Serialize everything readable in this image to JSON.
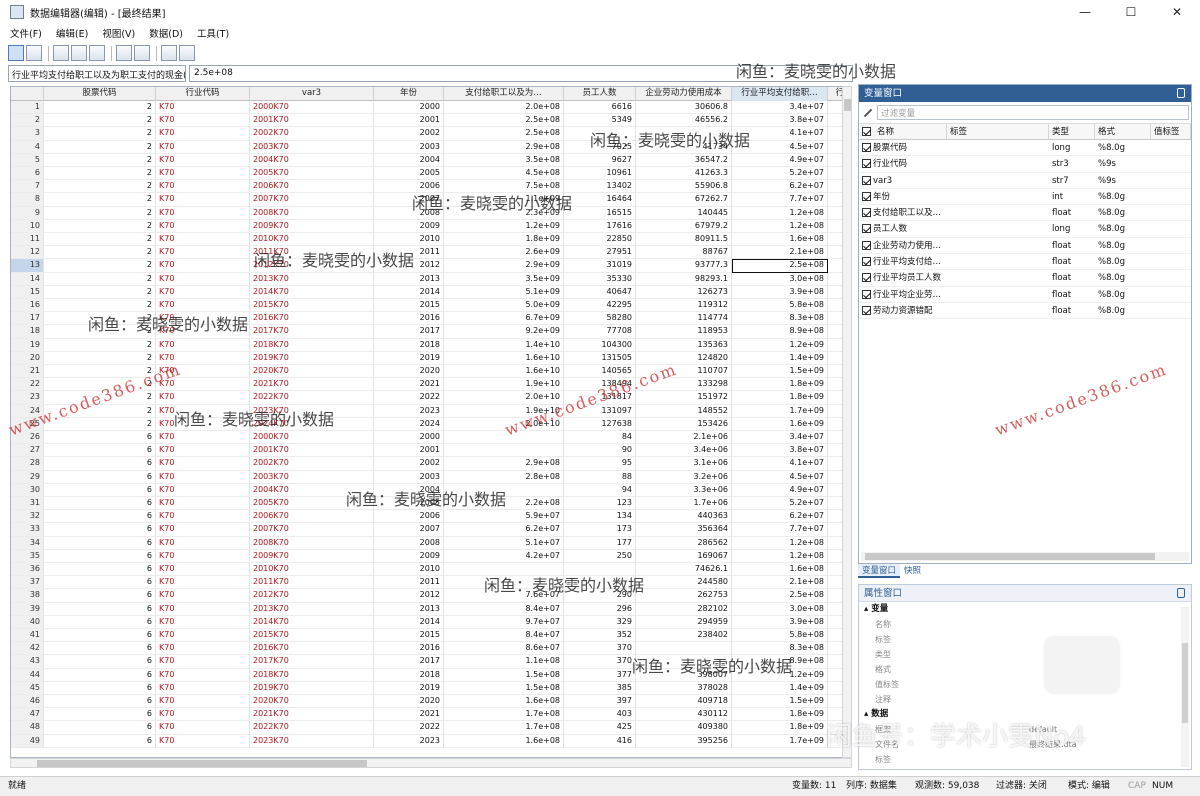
{
  "window": {
    "title": "数据编辑器(编辑) - [最终结果]",
    "minimize": "—",
    "maximize": "☐",
    "close": "✕"
  },
  "menu": [
    "文件(F)",
    "编辑(E)",
    "视图(V)",
    "数据(D)",
    "工具(T)"
  ],
  "toolbar_icons": [
    "grid-view-icon",
    "dropdown-grid-icon",
    "open-icon",
    "save-icon",
    "print-icon",
    "copy-icon",
    "paste-icon",
    "search-icon",
    "filter-icon"
  ],
  "cell_editor": {
    "variable_label": "行业平均支付给职工以及为职工支付的现金(",
    "value": "2.5e+08"
  },
  "grid": {
    "columns": [
      "股票代码",
      "行业代码",
      "var3",
      "年份",
      "支付给职工以及为…",
      "员工人数",
      "企业劳动力使用成本",
      "行业平均支付给职…",
      "行"
    ],
    "current_row": 13,
    "rows": [
      [
        "1",
        "2",
        "K70",
        "2000K70",
        "2000",
        "2.0e+08",
        "6616",
        "30606.8",
        "3.4e+07"
      ],
      [
        "2",
        "2",
        "K70",
        "2001K70",
        "2001",
        "2.5e+08",
        "5349",
        "46556.2",
        "3.8e+07"
      ],
      [
        "3",
        "2",
        "K70",
        "2002K70",
        "2002",
        "2.5e+08",
        "",
        "",
        "4.1e+07"
      ],
      [
        "4",
        "2",
        "K70",
        "2003K70",
        "2003",
        "2.9e+08",
        "7025",
        "41734",
        "4.5e+07"
      ],
      [
        "5",
        "2",
        "K70",
        "2004K70",
        "2004",
        "3.5e+08",
        "9627",
        "36547.2",
        "4.9e+07"
      ],
      [
        "6",
        "2",
        "K70",
        "2005K70",
        "2005",
        "4.5e+08",
        "10961",
        "41263.3",
        "5.2e+07"
      ],
      [
        "7",
        "2",
        "K70",
        "2006K70",
        "2006",
        "7.5e+08",
        "13402",
        "55906.8",
        "6.2e+07"
      ],
      [
        "8",
        "2",
        "K70",
        "2007K70",
        "2007",
        "1.1e+09",
        "16464",
        "67262.7",
        "7.7e+07"
      ],
      [
        "9",
        "2",
        "K70",
        "2008K70",
        "2008",
        "2.3e+09",
        "16515",
        "140445",
        "1.2e+08"
      ],
      [
        "10",
        "2",
        "K70",
        "2009K70",
        "2009",
        "1.2e+09",
        "17616",
        "67979.2",
        "1.2e+08"
      ],
      [
        "11",
        "2",
        "K70",
        "2010K70",
        "2010",
        "1.8e+09",
        "22850",
        "80911.5",
        "1.6e+08"
      ],
      [
        "12",
        "2",
        "K70",
        "2011K70",
        "2011",
        "2.6e+09",
        "27951",
        "88767",
        "2.1e+08"
      ],
      [
        "13",
        "2",
        "K70",
        "2012K70",
        "2012",
        "2.9e+09",
        "31019",
        "93777.3",
        "2.5e+08"
      ],
      [
        "14",
        "2",
        "K70",
        "2013K70",
        "2013",
        "3.5e+09",
        "35330",
        "98293.1",
        "3.0e+08"
      ],
      [
        "15",
        "2",
        "K70",
        "2014K70",
        "2014",
        "5.1e+09",
        "40647",
        "126273",
        "3.9e+08"
      ],
      [
        "16",
        "2",
        "K70",
        "2015K70",
        "2015",
        "5.0e+09",
        "42295",
        "119312",
        "5.8e+08"
      ],
      [
        "17",
        "2",
        "K70",
        "2016K70",
        "2016",
        "6.7e+09",
        "58280",
        "114774",
        "8.3e+08"
      ],
      [
        "18",
        "2",
        "K70",
        "2017K70",
        "2017",
        "9.2e+09",
        "77708",
        "118953",
        "8.9e+08"
      ],
      [
        "19",
        "2",
        "K70",
        "2018K70",
        "2018",
        "1.4e+10",
        "104300",
        "135363",
        "1.2e+09"
      ],
      [
        "20",
        "2",
        "K70",
        "2019K70",
        "2019",
        "1.6e+10",
        "131505",
        "124820",
        "1.4e+09"
      ],
      [
        "21",
        "2",
        "K70",
        "2020K70",
        "2020",
        "1.6e+10",
        "140565",
        "110707",
        "1.5e+09"
      ],
      [
        "22",
        "2",
        "K70",
        "2021K70",
        "2021",
        "1.9e+10",
        "138494",
        "133298",
        "1.8e+09"
      ],
      [
        "23",
        "2",
        "K70",
        "2022K70",
        "2022",
        "2.0e+10",
        "131817",
        "151972",
        "1.8e+09"
      ],
      [
        "24",
        "2",
        "K70",
        "2023K70",
        "2023",
        "1.9e+10",
        "131097",
        "148552",
        "1.7e+09"
      ],
      [
        "25",
        "2",
        "K70",
        "2024K70",
        "2024",
        "2.0e+10",
        "127638",
        "153426",
        "1.6e+09"
      ],
      [
        "26",
        "6",
        "K70",
        "2000K70",
        "2000",
        "",
        "84",
        "2.1e+06",
        "3.4e+07"
      ],
      [
        "27",
        "6",
        "K70",
        "2001K70",
        "2001",
        "",
        "90",
        "3.4e+06",
        "3.8e+07"
      ],
      [
        "28",
        "6",
        "K70",
        "2002K70",
        "2002",
        "2.9e+08",
        "95",
        "3.1e+06",
        "4.1e+07"
      ],
      [
        "29",
        "6",
        "K70",
        "2003K70",
        "2003",
        "2.8e+08",
        "88",
        "3.2e+06",
        "4.5e+07"
      ],
      [
        "30",
        "6",
        "K70",
        "2004K70",
        "2004",
        "",
        "94",
        "3.3e+06",
        "4.9e+07"
      ],
      [
        "31",
        "6",
        "K70",
        "2005K70",
        "2005",
        "2.2e+08",
        "123",
        "1.7e+06",
        "5.2e+07"
      ],
      [
        "32",
        "6",
        "K70",
        "2006K70",
        "2006",
        "5.9e+07",
        "134",
        "440363",
        "6.2e+07"
      ],
      [
        "33",
        "6",
        "K70",
        "2007K70",
        "2007",
        "6.2e+07",
        "173",
        "356364",
        "7.7e+07"
      ],
      [
        "34",
        "6",
        "K70",
        "2008K70",
        "2008",
        "5.1e+07",
        "177",
        "286562",
        "1.2e+08"
      ],
      [
        "35",
        "6",
        "K70",
        "2009K70",
        "2009",
        "4.2e+07",
        "250",
        "169067",
        "1.2e+08"
      ],
      [
        "36",
        "6",
        "K70",
        "2010K70",
        "2010",
        "",
        "",
        "74626.1",
        "1.6e+08"
      ],
      [
        "37",
        "6",
        "K70",
        "2011K70",
        "2011",
        "",
        "",
        "244580",
        "2.1e+08"
      ],
      [
        "38",
        "6",
        "K70",
        "2012K70",
        "2012",
        "7.6e+07",
        "290",
        "262753",
        "2.5e+08"
      ],
      [
        "39",
        "6",
        "K70",
        "2013K70",
        "2013",
        "8.4e+07",
        "296",
        "282102",
        "3.0e+08"
      ],
      [
        "40",
        "6",
        "K70",
        "2014K70",
        "2014",
        "9.7e+07",
        "329",
        "294959",
        "3.9e+08"
      ],
      [
        "41",
        "6",
        "K70",
        "2015K70",
        "2015",
        "8.4e+07",
        "352",
        "238402",
        "5.8e+08"
      ],
      [
        "42",
        "6",
        "K70",
        "2016K70",
        "2016",
        "8.6e+07",
        "370",
        "",
        "8.3e+08"
      ],
      [
        "43",
        "6",
        "K70",
        "2017K70",
        "2017",
        "1.1e+08",
        "370",
        "",
        "8.9e+08"
      ],
      [
        "44",
        "6",
        "K70",
        "2018K70",
        "2018",
        "1.5e+08",
        "377",
        "398007",
        "1.2e+09"
      ],
      [
        "45",
        "6",
        "K70",
        "2019K70",
        "2019",
        "1.5e+08",
        "385",
        "378028",
        "1.4e+09"
      ],
      [
        "46",
        "6",
        "K70",
        "2020K70",
        "2020",
        "1.6e+08",
        "397",
        "409718",
        "1.5e+09"
      ],
      [
        "47",
        "6",
        "K70",
        "2021K70",
        "2021",
        "1.7e+08",
        "403",
        "430112",
        "1.8e+09"
      ],
      [
        "48",
        "6",
        "K70",
        "2022K70",
        "2022",
        "1.7e+08",
        "425",
        "409380",
        "1.8e+09"
      ],
      [
        "49",
        "6",
        "K70",
        "2023K70",
        "2023",
        "1.6e+08",
        "416",
        "395256",
        "1.7e+09"
      ]
    ]
  },
  "variables_panel": {
    "title": "变量窗口",
    "filter_placeholder": "过滤变量",
    "headers": [
      "名称",
      "标签",
      "类型",
      "格式",
      "值标签"
    ],
    "rows": [
      [
        "股票代码",
        "",
        "long",
        "%8.0g"
      ],
      [
        "行业代码",
        "",
        "str3",
        "%9s"
      ],
      [
        "var3",
        "",
        "str7",
        "%9s"
      ],
      [
        "年份",
        "",
        "int",
        "%8.0g"
      ],
      [
        "支付给职工以及…",
        "",
        "float",
        "%8.0g"
      ],
      [
        "员工人数",
        "",
        "long",
        "%8.0g"
      ],
      [
        "企业劳动力使用…",
        "",
        "float",
        "%8.0g"
      ],
      [
        "行业平均支付给…",
        "",
        "float",
        "%8.0g"
      ],
      [
        "行业平均员工人数",
        "",
        "float",
        "%8.0g"
      ],
      [
        "行业平均企业劳…",
        "",
        "float",
        "%8.0g"
      ],
      [
        "劳动力资源错配",
        "",
        "float",
        "%8.0g"
      ]
    ],
    "tabs": [
      "变量窗口",
      "快照"
    ]
  },
  "properties_panel": {
    "title": "属性窗口",
    "section_variable": "变量",
    "variable_fields": [
      "名称",
      "标签",
      "类型",
      "格式",
      "值标签",
      "注释"
    ],
    "section_data": "数据",
    "data_fields": [
      "框架",
      "文件名",
      "标签"
    ],
    "frame_value": "default",
    "filename_value": "最终结果.dta"
  },
  "status": {
    "ready": "就绪",
    "var_count": "变量数: 11",
    "order": "列序: 数据集",
    "obs": "观测数: 59,038",
    "filter": "过滤器: 关闭",
    "mode": "模式: 编辑",
    "cap": "CAP",
    "num": "NUM"
  },
  "watermarks": {
    "xianyu": "闲鱼：麦晓雯的小数据",
    "url": "www.code386.com",
    "footer": "闲鱼号：学术小雯No4"
  },
  "colors": {
    "panel_title_bg": "#2f5f95",
    "string_text": "#b5161b",
    "header_bg": "#f0f0f0"
  }
}
